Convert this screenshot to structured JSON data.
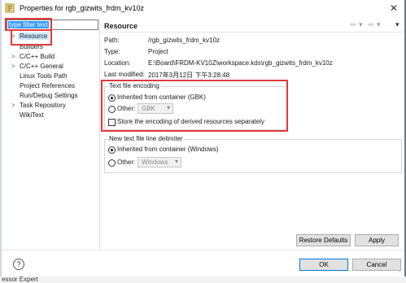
{
  "window": {
    "title": "Properties for rgb_gizwits_frdm_kv10z",
    "close_glyph": "✕"
  },
  "filter": {
    "placeholder": "type filter text"
  },
  "tree": [
    {
      "label": "Resource",
      "arrow": ">",
      "selected": true
    },
    {
      "label": "Builders",
      "arrow": ""
    },
    {
      "label": "C/C++ Build",
      "arrow": ">"
    },
    {
      "label": "C/C++ General",
      "arrow": ">"
    },
    {
      "label": "Linux Tools Path",
      "arrow": ""
    },
    {
      "label": "Project References",
      "arrow": ""
    },
    {
      "label": "Run/Debug Settings",
      "arrow": ""
    },
    {
      "label": "Task Repository",
      "arrow": ">"
    },
    {
      "label": "WikiText",
      "arrow": ""
    }
  ],
  "page": {
    "title": "Resource",
    "nav": {
      "back": "⇦",
      "back_menu": "▾",
      "forward": "⇨",
      "forward_menu": "▾",
      "view_menu": "▾"
    },
    "info": [
      {
        "key": "Path:",
        "value": "/rgb_gizwits_frdm_kv10z"
      },
      {
        "key": "Type:",
        "value": "Project"
      },
      {
        "key": "Location:",
        "value": "E:\\Board\\FRDM-KV10Z\\workspace.kds\\rgb_gizwits_frdm_kv10z"
      },
      {
        "key": "Last modified:",
        "value": "2017年3月12日 下午3:28:48"
      }
    ]
  },
  "encoding": {
    "group_title": "Text file encoding",
    "inherited_label": "Inherited from container (GBK)",
    "inherited_selected": true,
    "other_label": "Other:",
    "other_value": "GBK",
    "store_label": "Store the encoding of derived resources separately",
    "store_checked": false
  },
  "delimiter": {
    "group_title": "New text file line delimiter",
    "inherited_label": "Inherited from container (Windows)",
    "inherited_selected": true,
    "other_label": "Other:",
    "other_value": "Windows"
  },
  "buttons": {
    "restore_defaults": "Restore Defaults",
    "apply": "Apply",
    "ok": "OK",
    "cancel": "Cancel",
    "help": "?"
  },
  "background_text": "essor Expert",
  "colors": {
    "highlight_red": "#e23a3a",
    "selection": "#3399ff",
    "ok_border": "#0078d7"
  }
}
